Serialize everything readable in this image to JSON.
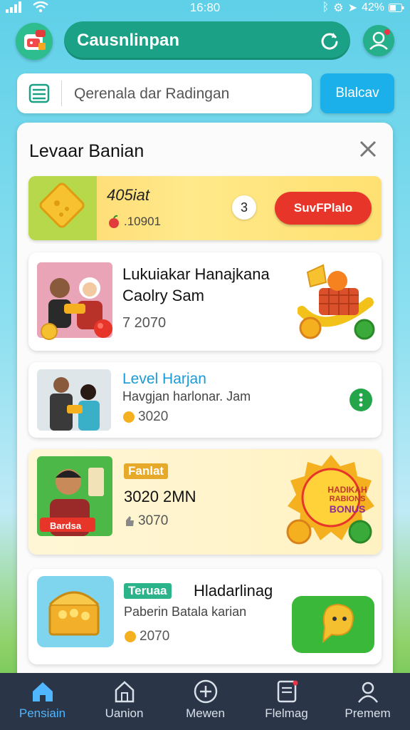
{
  "status_bar": {
    "time": "16:80",
    "battery": "42%"
  },
  "header": {
    "title": "Causnlinpan"
  },
  "search": {
    "placeholder": "Qerenala dar Radingan",
    "button_label": "Blalcav"
  },
  "panel": {
    "title": "Levaar Banian",
    "banner": {
      "amount": "405iat",
      "sub_value": ".10901",
      "count": "3",
      "button_label": "SuvFPlalo"
    },
    "items": [
      {
        "name_line1": "Lukuiakar Hanajkana",
        "name_line2": "Caolry Sam",
        "reward": "7 2070"
      },
      {
        "name": "Level Harjan",
        "desc": "Havgjan harlonar. Jam",
        "reward": "3020"
      },
      {
        "badge": "Fanlat",
        "name": "3020 2MN",
        "reward": "3070",
        "photo_tag": "Bardsa",
        "bonus_lines": [
          "HADIKAH",
          "RABIONS",
          "BONUS"
        ]
      },
      {
        "badge": "Teruaa",
        "name": "Hladarlinag",
        "desc": "Paberin Batala karian",
        "reward": "2070"
      }
    ]
  },
  "nav": [
    {
      "label": "Pensiain",
      "icon": "home-icon",
      "active": true
    },
    {
      "label": "Uanion",
      "icon": "house-outline-icon",
      "active": false
    },
    {
      "label": "Mewen",
      "icon": "plus-circle-icon",
      "active": false
    },
    {
      "label": "Flelmag",
      "icon": "document-icon",
      "active": false
    },
    {
      "label": "Premem",
      "icon": "user-icon",
      "active": false
    }
  ],
  "colors": {
    "header_pill": "#1aa186",
    "search_button": "#1cb0ea",
    "claim_button": "#e8352a",
    "bottom_nav": "#2a3547",
    "nav_active": "#4fb6ff",
    "level_name": "#1a9ad6"
  }
}
